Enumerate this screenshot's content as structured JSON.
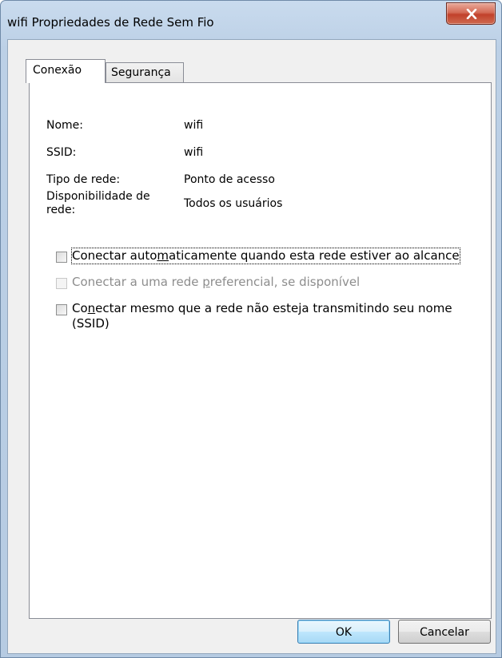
{
  "window": {
    "title": "wifi Propriedades de Rede Sem Fio",
    "close_icon": "close-x-icon"
  },
  "tabs": [
    {
      "label": "Conexão",
      "active": true
    },
    {
      "label": "Segurança",
      "active": false
    }
  ],
  "info": {
    "name_label": "Nome:",
    "name_value": "wifi",
    "ssid_label": "SSID:",
    "ssid_value": "wifi",
    "type_label": "Tipo de rede:",
    "type_value": "Ponto de acesso",
    "avail_label_line1": "Disponibilidade de",
    "avail_label_line2": "rede:",
    "avail_value": "Todos os usuários"
  },
  "options": {
    "auto_connect": {
      "label_pre": "Conectar auto",
      "label_key": "m",
      "label_post": "aticamente quando esta rede estiver ao alcance",
      "checked": false,
      "enabled": true
    },
    "preferred": {
      "label_pre": "Conectar a uma rede ",
      "label_key": "p",
      "label_post": "referencial, se disponível",
      "checked": false,
      "enabled": false
    },
    "hidden": {
      "label_pre": "Co",
      "label_key": "n",
      "label_post": "ectar mesmo que a rede não esteja transmitindo seu nome",
      "label_line2": "(SSID)",
      "checked": false,
      "enabled": true
    }
  },
  "buttons": {
    "ok": "OK",
    "cancel": "Cancelar"
  }
}
